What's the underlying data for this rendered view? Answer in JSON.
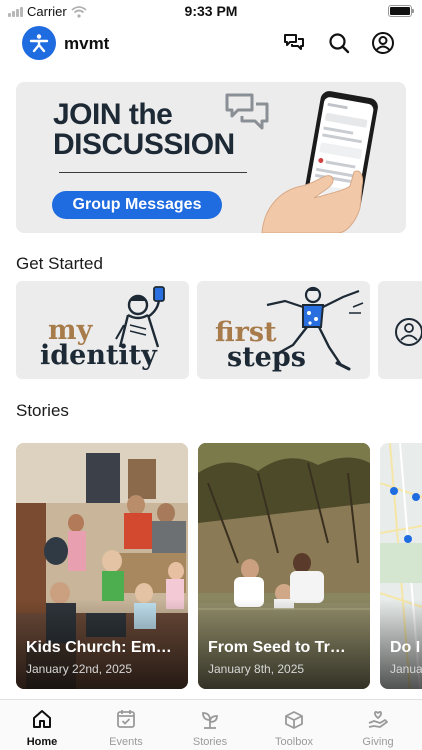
{
  "status_bar": {
    "carrier": "Carrier",
    "time": "9:33 PM"
  },
  "header": {
    "app_name": "mvmt"
  },
  "banner": {
    "title_line1": "JOIN the",
    "title_line2": "DISCUSSION",
    "button_label": "Group Messages"
  },
  "get_started": {
    "title": "Get Started",
    "cards": [
      {
        "word1": "my",
        "word2": "identity"
      },
      {
        "word1": "first",
        "word2": "steps"
      }
    ]
  },
  "stories": {
    "title": "Stories",
    "items": [
      {
        "title": "Kids Church: Em…",
        "date": "January 22nd, 2025"
      },
      {
        "title": "From Seed to Tr…",
        "date": "January 8th, 2025"
      },
      {
        "title": "Do I…",
        "date": "Janua…"
      }
    ]
  },
  "tab_bar": {
    "tabs": [
      {
        "label": "Home",
        "active": true
      },
      {
        "label": "Events",
        "active": false
      },
      {
        "label": "Stories",
        "active": false
      },
      {
        "label": "Toolbox",
        "active": false
      },
      {
        "label": "Giving",
        "active": false
      }
    ]
  },
  "colors": {
    "accent": "#1f6be0",
    "brown": "#a77b4a",
    "navy": "#1d2a35"
  }
}
